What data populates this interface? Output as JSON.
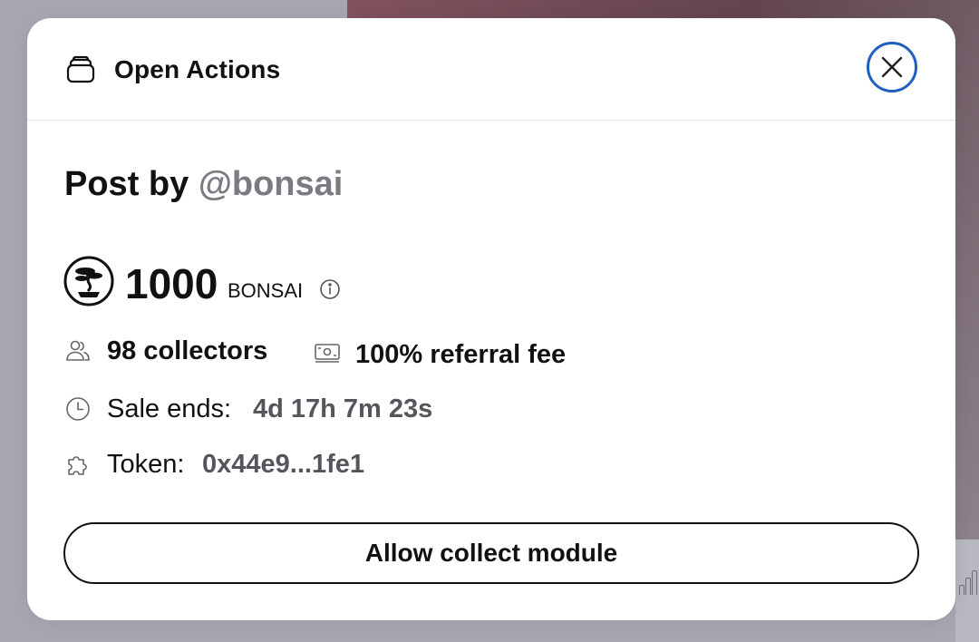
{
  "modal": {
    "title": "Open Actions",
    "icon": "stack-icon",
    "close_icon": "close-icon"
  },
  "post": {
    "prefix": "Post by",
    "handle": "@bonsai"
  },
  "price": {
    "amount": "1000",
    "symbol": "BONSAI",
    "logo": "bonsai-token-logo"
  },
  "stats": {
    "collectors": "98 collectors",
    "referral_fee": "100% referral fee",
    "sale_ends_label": "Sale ends:",
    "sale_ends_value": "4d 17h 7m 23s",
    "token_label": "Token:",
    "token_value": "0x44e9...1fe1"
  },
  "actions": {
    "allow_label": "Allow collect module"
  },
  "colors": {
    "close_ring": "#1f5fbf",
    "muted_text": "#7a7a82",
    "value_text": "#55555c"
  }
}
